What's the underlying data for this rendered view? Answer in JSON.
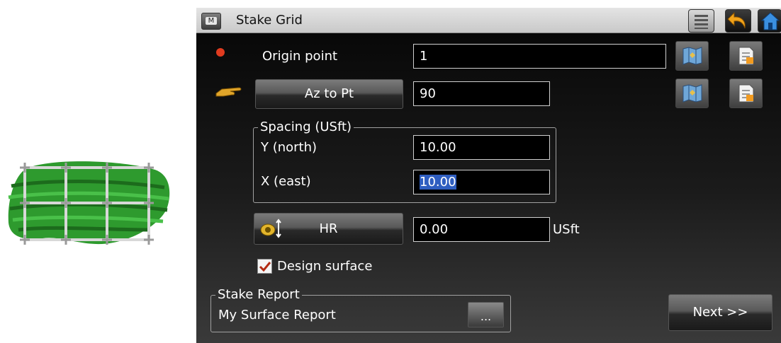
{
  "window": {
    "title": "Stake Grid",
    "menu_button_glyph": "M"
  },
  "titlebar_icons": [
    "list-icon",
    "undo-back-icon",
    "home-icon"
  ],
  "origin": {
    "label": "Origin point",
    "value": "1"
  },
  "azimuth": {
    "button_label": "Az to Pt",
    "value": "90"
  },
  "spacing": {
    "legend": "Spacing (USft)",
    "y_label": "Y (north)",
    "y_value": "10.00",
    "x_label": "X (east)",
    "x_value": "10.00"
  },
  "height": {
    "button_label": "HR",
    "value": "0.00",
    "unit": "USft"
  },
  "design_surface": {
    "label": "Design surface",
    "checked": true
  },
  "stake_report": {
    "legend": "Stake Report",
    "value": "My Surface Report",
    "browse_label": "..."
  },
  "next_label": "Next >>",
  "colors": {
    "selection": "#2f5ec0",
    "status_dot": "#e03b1f",
    "surface_green": "#2e9a2e",
    "pointer": "#e0a52a"
  }
}
